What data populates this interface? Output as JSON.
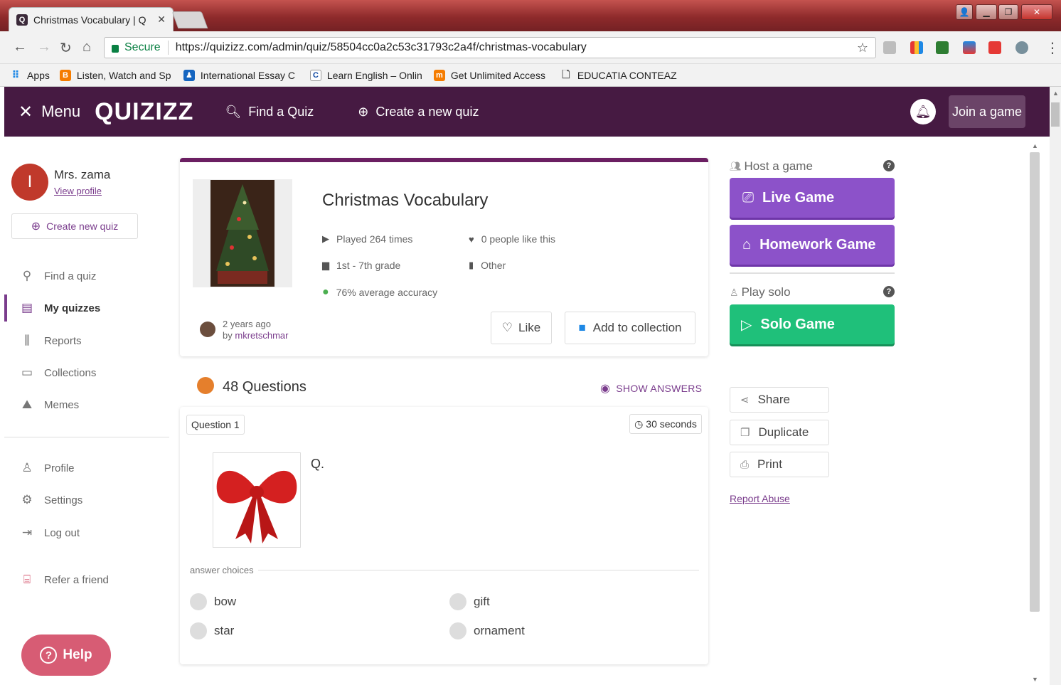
{
  "browser": {
    "tab_title": "Christmas Vocabulary | Q",
    "address": {
      "secure_label": "Secure",
      "url": "https://quizizz.com/admin/quiz/58504cc0a2c53c31793c2a4f/christmas-vocabulary"
    },
    "bookmarks": [
      {
        "label": "Apps",
        "icon": "apps-grid-icon"
      },
      {
        "label": "Listen, Watch and Sp",
        "icon": "bookmark-b-icon"
      },
      {
        "label": "International Essay C",
        "icon": "bookmark-person-icon"
      },
      {
        "label": "Learn English – Onlin",
        "icon": "bookmark-c-icon"
      },
      {
        "label": "Get Unlimited Access",
        "icon": "bookmark-m-icon"
      },
      {
        "label": "EDUCATIA CONTEAZ",
        "icon": "page-icon"
      }
    ]
  },
  "header": {
    "menu_label": "Menu",
    "logo": "QUIZIZZ",
    "find_quiz": "Find a Quiz",
    "create_quiz": "Create a new quiz",
    "join_game": "Join a game"
  },
  "sidebar": {
    "user_initial": "I",
    "user_name": "Mrs. zama",
    "view_profile": "View profile",
    "create_new_quiz": "Create new quiz",
    "nav": [
      {
        "label": "Find a quiz",
        "icon": "search-icon"
      },
      {
        "label": "My quizzes",
        "icon": "document-icon",
        "active": true
      },
      {
        "label": "Reports",
        "icon": "bar-chart-icon"
      },
      {
        "label": "Collections",
        "icon": "folder-icon"
      },
      {
        "label": "Memes",
        "icon": "image-icon"
      }
    ],
    "account": [
      {
        "label": "Profile",
        "icon": "user-icon"
      },
      {
        "label": "Settings",
        "icon": "gear-icon"
      },
      {
        "label": "Log out",
        "icon": "logout-icon"
      },
      {
        "label": "Refer a friend",
        "icon": "gift-icon"
      }
    ],
    "help": "Help"
  },
  "quiz": {
    "title": "Christmas Vocabulary",
    "played": "Played 264 times",
    "likes": "0 people like this",
    "grade": "1st - 7th grade",
    "subject": "Other",
    "accuracy": "76% average accuracy",
    "created": "2 years ago",
    "by_prefix": "by",
    "author": "mkretschmar",
    "like_btn": "Like",
    "collection_btn": "Add to collection"
  },
  "questions": {
    "count_label": "48 Questions",
    "show_answers": "SHOW ANSWERS",
    "first": {
      "number_label": "Question 1",
      "time_label": "30 seconds",
      "text": "Q.",
      "answer_choices_label": "answer choices",
      "choices": [
        "bow",
        "gift",
        "star",
        "ornament"
      ]
    }
  },
  "right": {
    "host_label": "Host a game",
    "live_game": "Live Game",
    "homework_game": "Homework Game",
    "play_solo_label": "Play solo",
    "solo_game": "Solo Game",
    "share": "Share",
    "duplicate": "Duplicate",
    "print": "Print",
    "report_abuse": "Report Abuse"
  },
  "colors": {
    "header_bg": "#461a42",
    "accent_purple": "#8c52c9",
    "solo_green": "#1fc07a",
    "link_purple": "#7a3c8c",
    "help_pink": "#d75c74"
  }
}
